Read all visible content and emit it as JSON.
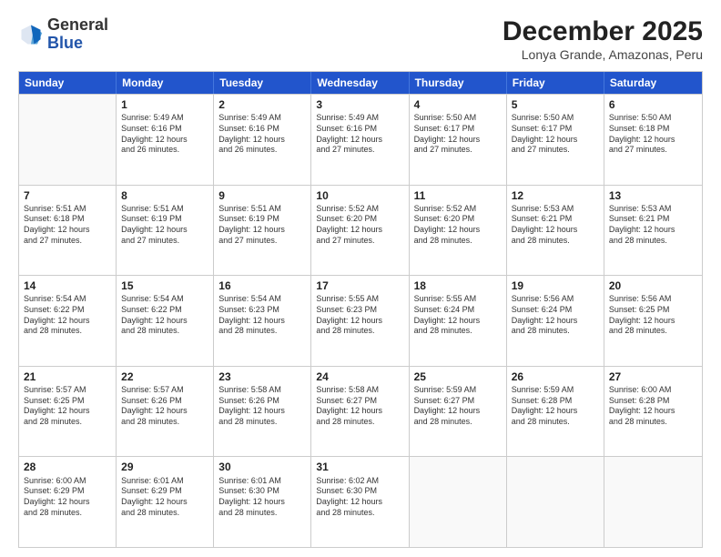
{
  "logo": {
    "general": "General",
    "blue": "Blue"
  },
  "title": "December 2025",
  "subtitle": "Lonya Grande, Amazonas, Peru",
  "days": [
    "Sunday",
    "Monday",
    "Tuesday",
    "Wednesday",
    "Thursday",
    "Friday",
    "Saturday"
  ],
  "weeks": [
    [
      {
        "day": "",
        "info": ""
      },
      {
        "day": "1",
        "info": "Sunrise: 5:49 AM\nSunset: 6:16 PM\nDaylight: 12 hours\nand 26 minutes."
      },
      {
        "day": "2",
        "info": "Sunrise: 5:49 AM\nSunset: 6:16 PM\nDaylight: 12 hours\nand 26 minutes."
      },
      {
        "day": "3",
        "info": "Sunrise: 5:49 AM\nSunset: 6:16 PM\nDaylight: 12 hours\nand 27 minutes."
      },
      {
        "day": "4",
        "info": "Sunrise: 5:50 AM\nSunset: 6:17 PM\nDaylight: 12 hours\nand 27 minutes."
      },
      {
        "day": "5",
        "info": "Sunrise: 5:50 AM\nSunset: 6:17 PM\nDaylight: 12 hours\nand 27 minutes."
      },
      {
        "day": "6",
        "info": "Sunrise: 5:50 AM\nSunset: 6:18 PM\nDaylight: 12 hours\nand 27 minutes."
      }
    ],
    [
      {
        "day": "7",
        "info": "Sunrise: 5:51 AM\nSunset: 6:18 PM\nDaylight: 12 hours\nand 27 minutes."
      },
      {
        "day": "8",
        "info": "Sunrise: 5:51 AM\nSunset: 6:19 PM\nDaylight: 12 hours\nand 27 minutes."
      },
      {
        "day": "9",
        "info": "Sunrise: 5:51 AM\nSunset: 6:19 PM\nDaylight: 12 hours\nand 27 minutes."
      },
      {
        "day": "10",
        "info": "Sunrise: 5:52 AM\nSunset: 6:20 PM\nDaylight: 12 hours\nand 27 minutes."
      },
      {
        "day": "11",
        "info": "Sunrise: 5:52 AM\nSunset: 6:20 PM\nDaylight: 12 hours\nand 28 minutes."
      },
      {
        "day": "12",
        "info": "Sunrise: 5:53 AM\nSunset: 6:21 PM\nDaylight: 12 hours\nand 28 minutes."
      },
      {
        "day": "13",
        "info": "Sunrise: 5:53 AM\nSunset: 6:21 PM\nDaylight: 12 hours\nand 28 minutes."
      }
    ],
    [
      {
        "day": "14",
        "info": "Sunrise: 5:54 AM\nSunset: 6:22 PM\nDaylight: 12 hours\nand 28 minutes."
      },
      {
        "day": "15",
        "info": "Sunrise: 5:54 AM\nSunset: 6:22 PM\nDaylight: 12 hours\nand 28 minutes."
      },
      {
        "day": "16",
        "info": "Sunrise: 5:54 AM\nSunset: 6:23 PM\nDaylight: 12 hours\nand 28 minutes."
      },
      {
        "day": "17",
        "info": "Sunrise: 5:55 AM\nSunset: 6:23 PM\nDaylight: 12 hours\nand 28 minutes."
      },
      {
        "day": "18",
        "info": "Sunrise: 5:55 AM\nSunset: 6:24 PM\nDaylight: 12 hours\nand 28 minutes."
      },
      {
        "day": "19",
        "info": "Sunrise: 5:56 AM\nSunset: 6:24 PM\nDaylight: 12 hours\nand 28 minutes."
      },
      {
        "day": "20",
        "info": "Sunrise: 5:56 AM\nSunset: 6:25 PM\nDaylight: 12 hours\nand 28 minutes."
      }
    ],
    [
      {
        "day": "21",
        "info": "Sunrise: 5:57 AM\nSunset: 6:25 PM\nDaylight: 12 hours\nand 28 minutes."
      },
      {
        "day": "22",
        "info": "Sunrise: 5:57 AM\nSunset: 6:26 PM\nDaylight: 12 hours\nand 28 minutes."
      },
      {
        "day": "23",
        "info": "Sunrise: 5:58 AM\nSunset: 6:26 PM\nDaylight: 12 hours\nand 28 minutes."
      },
      {
        "day": "24",
        "info": "Sunrise: 5:58 AM\nSunset: 6:27 PM\nDaylight: 12 hours\nand 28 minutes."
      },
      {
        "day": "25",
        "info": "Sunrise: 5:59 AM\nSunset: 6:27 PM\nDaylight: 12 hours\nand 28 minutes."
      },
      {
        "day": "26",
        "info": "Sunrise: 5:59 AM\nSunset: 6:28 PM\nDaylight: 12 hours\nand 28 minutes."
      },
      {
        "day": "27",
        "info": "Sunrise: 6:00 AM\nSunset: 6:28 PM\nDaylight: 12 hours\nand 28 minutes."
      }
    ],
    [
      {
        "day": "28",
        "info": "Sunrise: 6:00 AM\nSunset: 6:29 PM\nDaylight: 12 hours\nand 28 minutes."
      },
      {
        "day": "29",
        "info": "Sunrise: 6:01 AM\nSunset: 6:29 PM\nDaylight: 12 hours\nand 28 minutes."
      },
      {
        "day": "30",
        "info": "Sunrise: 6:01 AM\nSunset: 6:30 PM\nDaylight: 12 hours\nand 28 minutes."
      },
      {
        "day": "31",
        "info": "Sunrise: 6:02 AM\nSunset: 6:30 PM\nDaylight: 12 hours\nand 28 minutes."
      },
      {
        "day": "",
        "info": ""
      },
      {
        "day": "",
        "info": ""
      },
      {
        "day": "",
        "info": ""
      }
    ]
  ]
}
